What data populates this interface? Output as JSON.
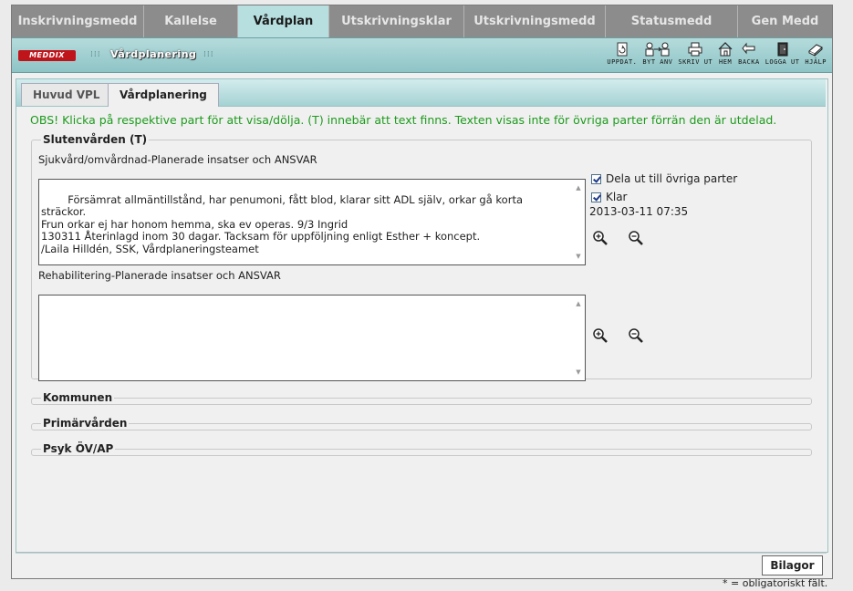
{
  "top_tabs": [
    {
      "label": "Inskrivningsmedd",
      "active": false
    },
    {
      "label": "Kallelse",
      "active": false
    },
    {
      "label": "Vårdplan",
      "active": true
    },
    {
      "label": "Utskrivningsklar",
      "active": false
    },
    {
      "label": "Utskrivningsmedd",
      "active": false
    },
    {
      "label": "Statusmedd",
      "active": false
    },
    {
      "label": "Gen Medd",
      "active": false
    }
  ],
  "toolbar": {
    "logo": "MEDDIX",
    "title": "Vårdplanering",
    "tools": [
      {
        "label": "UPPDAT.",
        "icon": "refresh-document-icon"
      },
      {
        "label": "BYT ANV",
        "icon": "switch-user-icon"
      },
      {
        "label": "SKRIV UT",
        "icon": "printer-icon"
      },
      {
        "label": "HEM",
        "icon": "home-icon"
      },
      {
        "label": "BACKA",
        "icon": "back-arrow-icon"
      },
      {
        "label": "LOGGA UT",
        "icon": "logout-door-icon"
      },
      {
        "label": "HJÄLP",
        "icon": "help-book-icon"
      }
    ]
  },
  "sub_tabs": {
    "huvud": "Huvud VPL",
    "vardplanering": "Vårdplanering"
  },
  "notice": "OBS! Klicka på respektive part för att visa/dölja. (T) innebär att text finns. Texten visas inte för övriga parter förrän den är utdelad.",
  "slutenvarden": {
    "legend": "Slutenvården (T)",
    "field1_label": "Sjukvård/omvårdnad-Planerade insatser och ANSVAR",
    "field1_text": "Försämrat allmäntillstånd, har penumoni, fått blod, klarar sitt ADL själv, orkar gå korta sträckor.\nFrun orkar ej har honom hemma, ska ev operas. 9/3 Ingrid\n130311 Återinlagd inom 30 dagar. Tacksam för uppföljning enligt Esther + koncept.\n/Laila Hilldén, SSK, Vårdplaneringsteamet",
    "share_label": "Dela ut till övriga parter",
    "share_checked": true,
    "done_label": "Klar",
    "done_checked": true,
    "timestamp": "2013-03-11 07:35",
    "field2_label": "Rehabilitering-Planerade insatser och ANSVAR",
    "field2_text": ""
  },
  "sections": {
    "kommunen": "Kommunen",
    "primarvarden": "Primärvården",
    "psyk": "Psyk ÖV/AP"
  },
  "bilagor_label": "Bilagor",
  "footnote": "* = obligatoriskt fält."
}
